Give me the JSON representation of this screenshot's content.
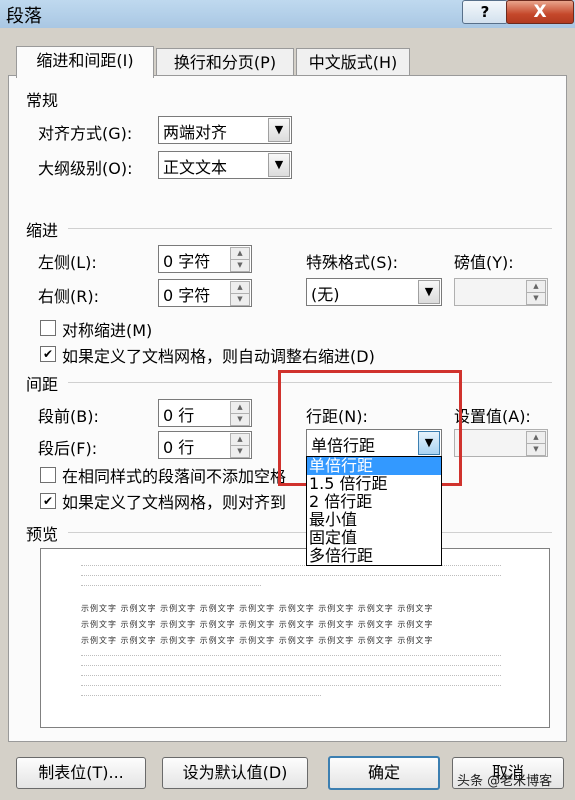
{
  "window": {
    "title": "段落",
    "help_label": "?",
    "close_label": "X"
  },
  "tabs": [
    {
      "label": "缩进和间距(I)"
    },
    {
      "label": "换行和分页(P)"
    },
    {
      "label": "中文版式(H)"
    }
  ],
  "general": {
    "title": "常规",
    "alignment_label": "对齐方式(G):",
    "alignment_value": "两端对齐",
    "outline_label": "大纲级别(O):",
    "outline_value": "正文文本"
  },
  "indent": {
    "title": "缩进",
    "left_label": "左侧(L):",
    "left_value": "0 字符",
    "right_label": "右侧(R):",
    "right_value": "0 字符",
    "special_label": "特殊格式(S):",
    "special_value": "(无)",
    "measure_label": "磅值(Y):",
    "mirror_label": "对称缩进(M)",
    "mirror_checked": false,
    "auto_adjust_label": "如果定义了文档网格，则自动调整右缩进(D)",
    "auto_adjust_checked": true
  },
  "spacing": {
    "title": "间距",
    "before_label": "段前(B):",
    "before_value": "0 行",
    "after_label": "段后(F):",
    "after_value": "0 行",
    "line_spacing_label": "行距(N):",
    "line_spacing_value": "单倍行距",
    "set_value_label": "设置值(A):",
    "no_space_label": "在相同样式的段落间不添加空格",
    "no_space_checked": false,
    "snap_grid_label": "如果定义了文档网格，则对齐到",
    "snap_grid_checked": true,
    "line_spacing_options": [
      "单倍行距",
      "1.5 倍行距",
      "2 倍行距",
      "最小值",
      "固定值",
      "多倍行距"
    ],
    "selected_option_index": 0
  },
  "preview": {
    "title": "预览",
    "sample_text": "示例文字 示例文字 示例文字 示例文字 示例文字 示例文字 示例文字 示例文字 示例文字"
  },
  "buttons": {
    "tabs_label": "制表位(T)...",
    "default_label": "设为默认值(D)",
    "ok_label": "确定",
    "cancel_label": "取消"
  },
  "watermark": "头条 @老米博客",
  "colors": {
    "highlight": "#d0322d",
    "selection": "#3399ff"
  }
}
